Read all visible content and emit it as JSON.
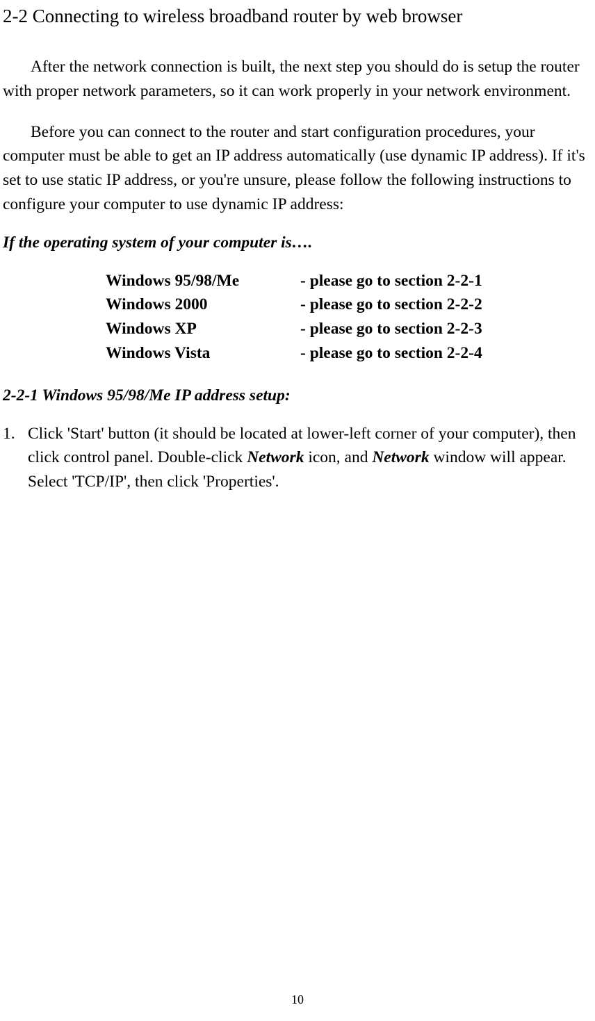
{
  "section_title": "2-2 Connecting to wireless broadband router by web browser",
  "para1": "After the network connection is built, the next step you should do is setup the router with proper network parameters, so it can work properly in your network environment.",
  "para2": "Before you can connect to the router and start configuration procedures, your computer must be able to get an IP address automatically (use dynamic IP address). If it's set to use static IP address, or you're unsure, please follow the following instructions to configure your computer to use dynamic IP address:",
  "os_intro": "If the operating system of your computer is….",
  "os_rows": [
    {
      "name": "Windows 95/98/Me",
      "section": "- please go to section 2-2-1"
    },
    {
      "name": "Windows 2000",
      "section": "- please go to section 2-2-2"
    },
    {
      "name": "Windows XP",
      "section": "- please go to section 2-2-3"
    },
    {
      "name": "Windows Vista",
      "section": "- please go to section 2-2-4"
    }
  ],
  "subsection_title": "2-2-1 Windows 95/98/Me IP address setup:",
  "step1": {
    "number": "1.",
    "pre1": "Click 'Start' button (it should be located at lower-left corner of your computer), then click control panel. Double-click ",
    "net1": "Network",
    "mid1": " icon, and ",
    "net2": "Network",
    "post1": " window will appear. Select 'TCP/IP', then click 'Properties'."
  },
  "page_number": "10"
}
